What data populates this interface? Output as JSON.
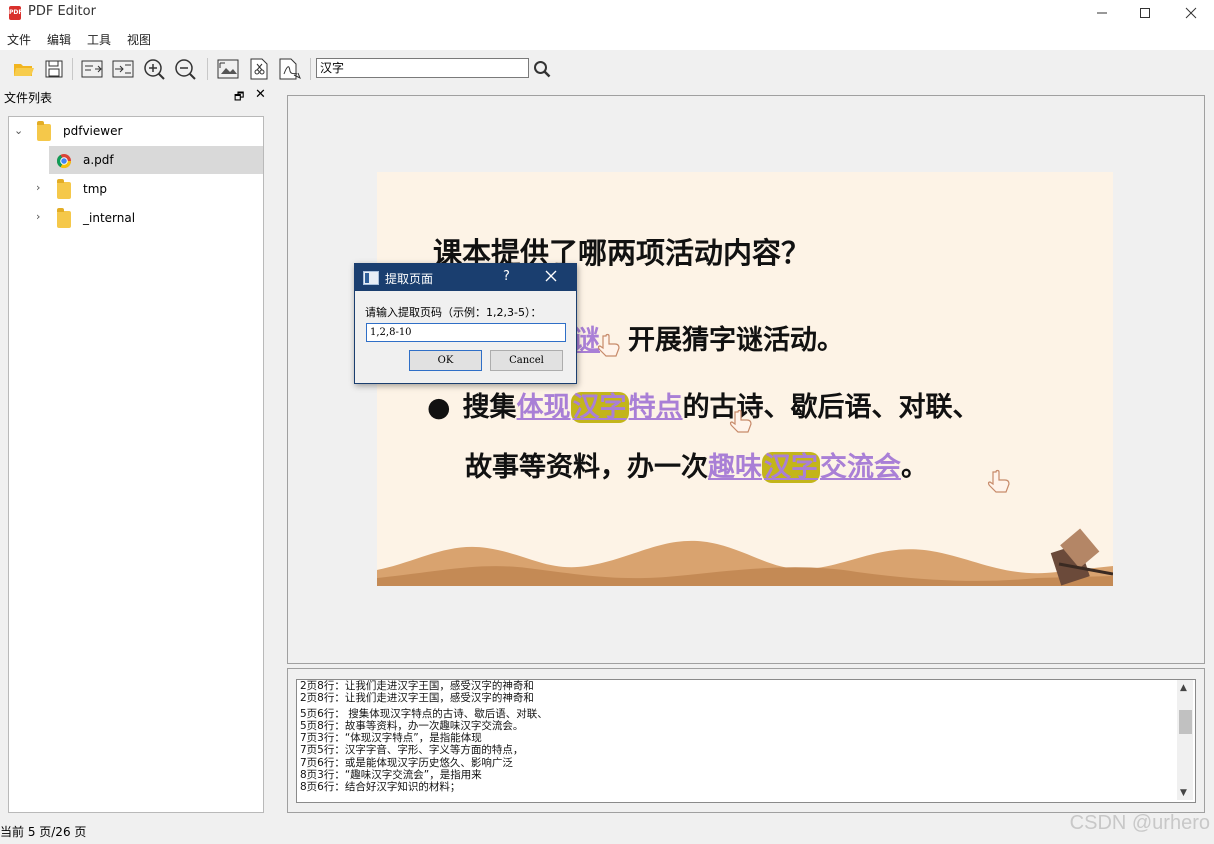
{
  "window": {
    "title": "PDF Editor",
    "icon_text": "PDF"
  },
  "menu": [
    "文件",
    "编辑",
    "工具",
    "视图"
  ],
  "toolbar": {
    "icons": [
      "open-folder-icon",
      "save-icon",
      "page-extract-icon",
      "page-insert-icon",
      "zoom-in-icon",
      "zoom-out-icon",
      "image-export-icon",
      "cut-page-icon",
      "pdf-convert-icon",
      "search-icon"
    ],
    "search_value": "汉字"
  },
  "dock": {
    "title": "文件列表"
  },
  "tree": [
    {
      "label": "pdfviewer",
      "type": "folder",
      "expanded": true
    },
    {
      "label": "a.pdf",
      "type": "pdf",
      "selected": true
    },
    {
      "label": "tmp",
      "type": "folder",
      "expanded": false
    },
    {
      "label": "_internal",
      "type": "folder",
      "expanded": false
    }
  ],
  "slide": {
    "heading": "课本提供了哪两项活动内容？",
    "bullet_partial_link": "谜",
    "line1_rest": "开展猜字谜活动。",
    "bullet": "●",
    "line2_a": "搜集",
    "line2_link_a": "体现",
    "line2_hl": "汉字",
    "line2_link_b": "特点",
    "line2_rest": "的古诗、歇后语、对联、",
    "line3_a": "故事等资料，办一次",
    "line3_link_a": "趣味",
    "line3_hl": "汉字",
    "line3_link_b": "交流会",
    "line3_end": "。"
  },
  "dialog": {
    "title": "提取页面",
    "help": "?",
    "prompt": "请输入提取页码（示例：1,2,3-5）：",
    "value": "1,2,8-10",
    "ok": "OK",
    "cancel": "Cancel"
  },
  "output_lines": [
    "2页8行：让我们走进汉字王国，感受汉字的神奇和",
    "2页8行：让我们走进汉字王国，感受汉字的神奇和",
    "5页6行：   搜集体现汉字特点的古诗、歇后语、对联、",
    "5页8行：故事等资料，办一次趣味汉字交流会。",
    "7页3行：“体现汉字特点”，是指能体现",
    "7页5行：汉字字音、字形、字义等方面的特点，",
    "7页6行：或是能体现汉字历史悠久、影响广泛",
    "8页3行：“趣味汉字交流会”，是指用来",
    "8页6行：结合好汉字知识的材料；"
  ],
  "status": "当前 5 页/26 页",
  "watermark": "CSDN @urhero",
  "colors": {
    "dialog_title": "#1a3e6f",
    "link": "#a97fd6",
    "highlight": "#c3b51a",
    "page_bg": "#fdf3e6"
  }
}
